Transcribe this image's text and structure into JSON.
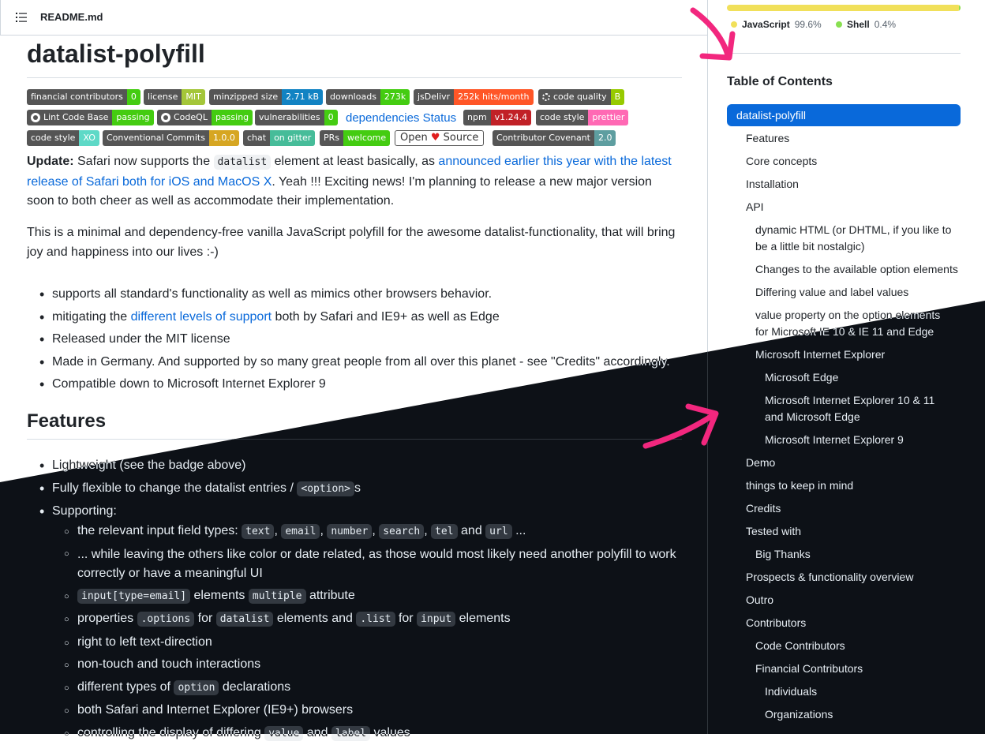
{
  "readme": {
    "filename": "README.md"
  },
  "title": "datalist-polyfill",
  "badges": {
    "row1": [
      {
        "label": "financial contributors",
        "value": "0",
        "color": "#4c1"
      },
      {
        "label": "license",
        "value": "MIT",
        "color": "#a4c639"
      },
      {
        "label": "minzipped size",
        "value": "2.71 kB",
        "color": "#1283c3"
      },
      {
        "label": "downloads",
        "value": "273k",
        "color": "#4c1"
      },
      {
        "label": "jsDelivr",
        "value": "252k hits/month",
        "color": "#ff5627"
      },
      {
        "label": "code quality",
        "value": "B",
        "color": "#97ca00"
      }
    ],
    "row2": [
      {
        "label": "Lint Code Base",
        "value": "passing",
        "color": "#4c1"
      },
      {
        "label": "CodeQL",
        "value": "passing",
        "color": "#4c1"
      },
      {
        "label": "vulnerabilities",
        "value": "0",
        "color": "#4c1"
      }
    ],
    "dependencies_link": "dependencies Status",
    "row2b": [
      {
        "label": "npm",
        "value": "v1.24.4",
        "color": "#c12127"
      },
      {
        "label": "code style",
        "value": "prettier",
        "color": "#ff69b4"
      }
    ],
    "row3": [
      {
        "label": "code style",
        "value": "XO",
        "color": "#5ed9c7"
      },
      {
        "label": "Conventional Commits",
        "value": "1.0.0",
        "color": "#d6a622"
      },
      {
        "label": "chat",
        "value": "on gitter",
        "color": "#46bc99"
      },
      {
        "label": "PRs",
        "value": "welcome",
        "color": "#4c1"
      }
    ],
    "open_source": {
      "left": "Open",
      "right": "Source"
    },
    "covenant": {
      "label": "Contributor Covenant",
      "value": "2.0",
      "color": "#5e9ea0"
    }
  },
  "update": {
    "bold": "Update:",
    "t1": " Safari now supports the ",
    "code": "datalist",
    "t2": " element at least basically, as ",
    "link": "announced earlier this year with the latest release of Safari both for iOS and MacOS X",
    "t3": ". Yeah !!! Exciting news! I'm planning to release a new major version soon to both cheer as well as accommodate their implementation."
  },
  "intro": "This is a minimal and dependency-free vanilla JavaScript polyfill for the awesome datalist-functionality, that will bring joy and happiness into our lives :-)",
  "bullets": {
    "b1": "supports all standard's functionality as well as mimics other browsers behavior.",
    "b2_pre": "mitigating the ",
    "b2_link": "different levels of support",
    "b2_post": " both by Safari and IE9+ as well as Edge",
    "b3": "Released under the MIT license",
    "b4": "Made in Germany. And supported by so many great people from all over this planet - see \"Credits\" accordingly.",
    "b5": "Compatible down to Microsoft Internet Explorer 9"
  },
  "features": {
    "heading": "Features",
    "f1": "Lightweight (see the badge above)",
    "f2_pre": "Fully flexible to change the datalist entries / ",
    "f2_code": "<option>",
    "f2_post": "s",
    "f3": "Supporting:",
    "s1_pre": "the relevant input field types: ",
    "s1_codes": [
      "text",
      "email",
      "number",
      "search",
      "tel",
      "url"
    ],
    "s1_and": "and",
    "s1_post": " ...",
    "s2": "... while leaving the others like color or date related, as those would most likely need another polyfill to work correctly or have a meaningful UI",
    "s3_code1": "input[type=email]",
    "s3_mid": " elements ",
    "s3_code2": "multiple",
    "s3_post": " attribute",
    "s4_pre": "properties ",
    "s4_c1": ".options",
    "s4_m1": " for ",
    "s4_c2": "datalist",
    "s4_m2": " elements and ",
    "s4_c3": ".list",
    "s4_m3": " for ",
    "s4_c4": "input",
    "s4_post": " elements",
    "s5": "right to left text-direction",
    "s6": "non-touch and touch interactions",
    "s7_pre": "different types of ",
    "s7_code": "option",
    "s7_post": " declarations",
    "s8": "both Safari and Internet Explorer (IE9+) browsers",
    "s9_pre": "controlling the display of differing ",
    "s9_c1": "value",
    "s9_m": " and ",
    "s9_c2": "label",
    "s9_post": " values"
  },
  "languages": [
    {
      "name": "JavaScript",
      "pct": "99.6%",
      "color": "#f1e05a"
    },
    {
      "name": "Shell",
      "pct": "0.4%",
      "color": "#89e051"
    }
  ],
  "toc": {
    "title": "Table of Contents",
    "items": [
      "datalist-polyfill",
      "Features",
      "Core concepts",
      "Installation",
      "API",
      "dynamic HTML (or DHTML, if you like to be a little bit nostalgic)",
      "Changes to the available option elements",
      "Differing value and label values",
      "value property on the option elements for Microsoft IE 10 & IE 11 and Edge",
      "Microsoft Internet Explorer",
      "Microsoft Edge",
      "Microsoft Internet Explorer 10 & 11 and Microsoft Edge",
      "Microsoft Internet Explorer 9",
      "Demo",
      "things to keep in mind",
      "Credits",
      "Tested with",
      "Big Thanks",
      "Prospects & functionality overview",
      "Outro",
      "Contributors",
      "Code Contributors",
      "Financial Contributors",
      "Individuals",
      "Organizations"
    ]
  },
  "colors": {
    "accent": "#0969da",
    "arrow": "#f2277e",
    "dark_bg": "#0d1117"
  }
}
